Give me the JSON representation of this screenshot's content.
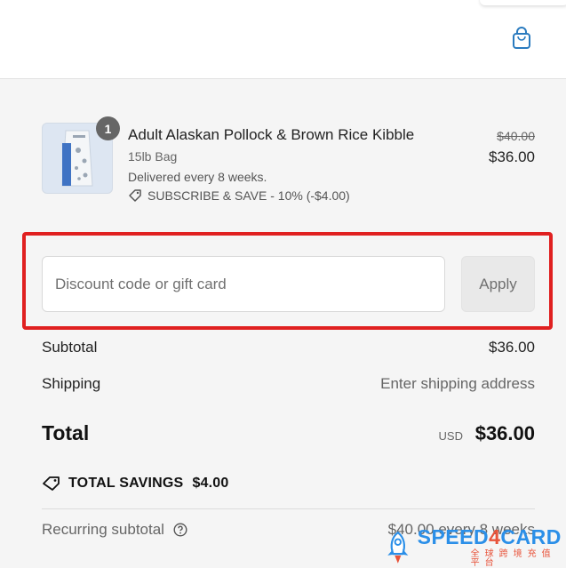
{
  "header": {
    "cart_icon": "shopping-bag-icon"
  },
  "line_item": {
    "quantity": "1",
    "name": "Adult Alaskan Pollock & Brown Rice Kibble",
    "variant": "15lb Bag",
    "delivery": "Delivered every 8 weeks.",
    "subscribe_note": "SUBSCRIBE & SAVE - 10% (-$4.00)",
    "original_price": "$40.00",
    "price": "$36.00"
  },
  "discount": {
    "placeholder": "Discount code or gift card",
    "value": "",
    "apply_label": "Apply",
    "highlight_color": "#e02020"
  },
  "summary": {
    "subtotal_label": "Subtotal",
    "subtotal_value": "$36.00",
    "shipping_label": "Shipping",
    "shipping_value": "Enter shipping address",
    "total_label": "Total",
    "total_currency": "USD",
    "total_value": "$36.00",
    "savings_label": "TOTAL SAVINGS",
    "savings_value": "$4.00",
    "recurring_label": "Recurring subtotal",
    "recurring_value": "$40.00 every 8 weeks"
  },
  "watermark": {
    "brand_prefix": "SPEED",
    "brand_four": "4",
    "brand_suffix": "CARD",
    "tagline": "全球跨境充值平台"
  }
}
